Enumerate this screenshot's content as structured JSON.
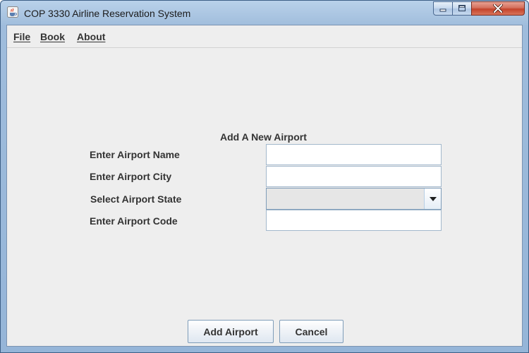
{
  "window": {
    "title": "COP 3330 Airline Reservation System",
    "icons": {
      "app": "java-cup-icon",
      "minimize": "minimize-icon",
      "maximize": "maximize-icon",
      "close": "close-icon"
    }
  },
  "menubar": {
    "items": [
      {
        "label": "File"
      },
      {
        "label": "Book"
      },
      {
        "label": "About"
      }
    ]
  },
  "form": {
    "heading": "Add A New Airport",
    "name_label": "Enter Airport Name",
    "name_value": "",
    "city_label": "Enter Airport City",
    "city_value": "",
    "state_label": "Select Airport State",
    "state_value": "",
    "code_label": "Enter Airport Code",
    "code_value": ""
  },
  "buttons": {
    "add": "Add Airport",
    "cancel": "Cancel"
  },
  "colors": {
    "frame_accent": "#9fbcdc",
    "close_button": "#c4432b",
    "panel_background": "#eeeeee"
  }
}
